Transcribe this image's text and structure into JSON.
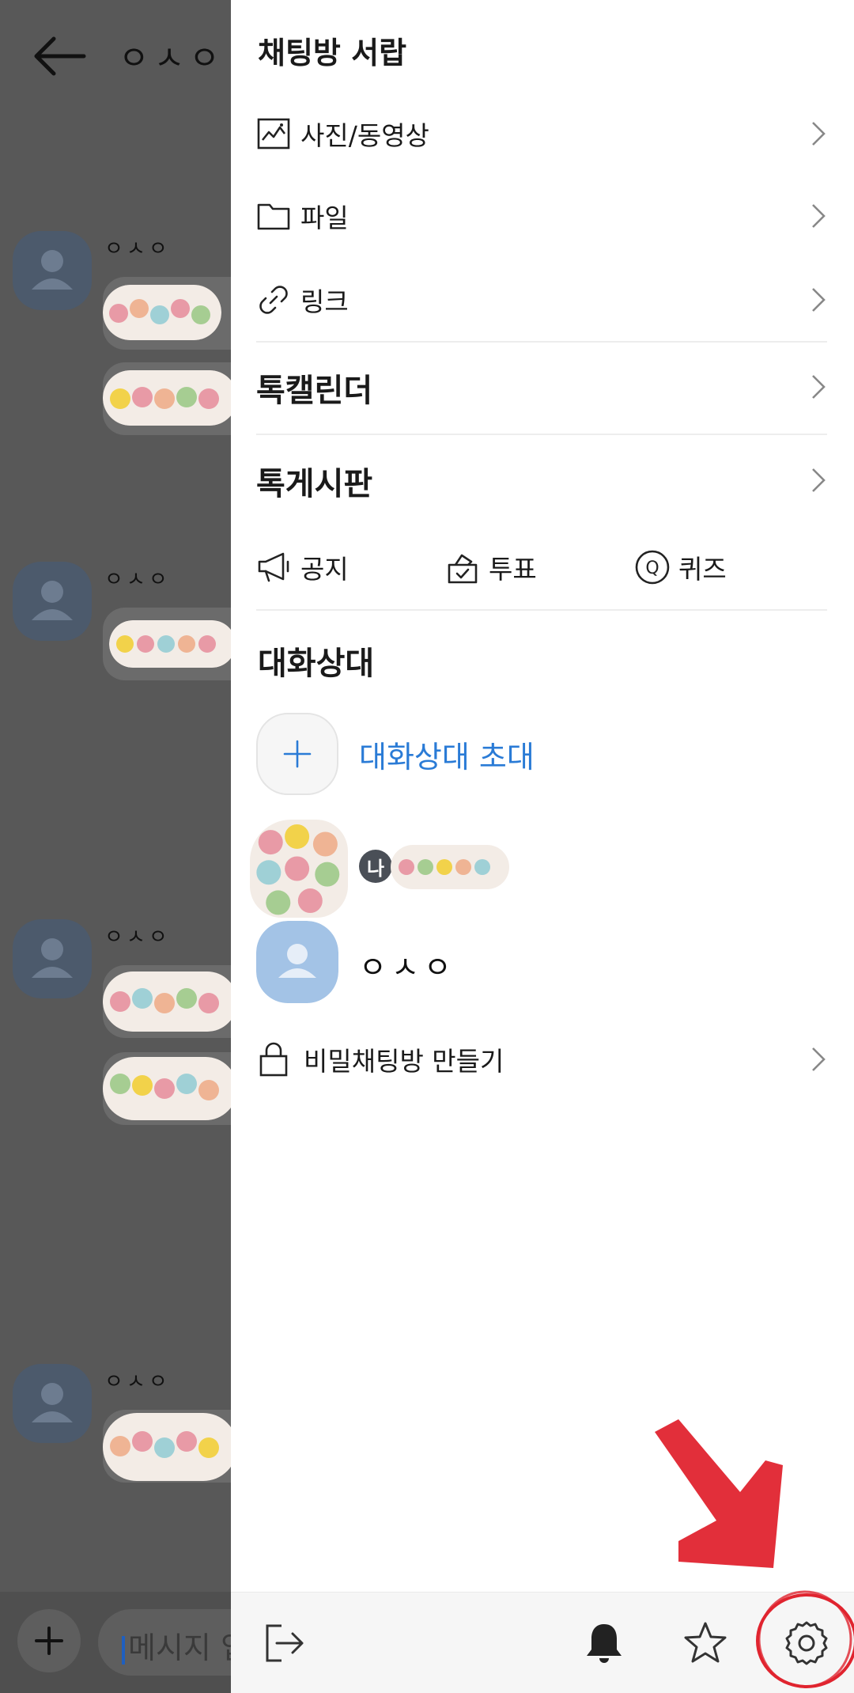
{
  "chat": {
    "title": "ㅇㅅㅇ",
    "messages": [
      {
        "sender": "ㅇㅅㅇ"
      },
      {
        "sender": "ㅇㅅㅇ"
      },
      {
        "sender": "ㅇㅅㅇ"
      },
      {
        "sender": "ㅇㅅㅇ"
      }
    ],
    "input_placeholder": "메시지 입"
  },
  "drawer": {
    "title": "채팅방 서랍",
    "items": [
      {
        "label": "사진/동영상",
        "icon": "photo-icon"
      },
      {
        "label": "파일",
        "icon": "folder-icon"
      },
      {
        "label": "링크",
        "icon": "link-icon"
      }
    ],
    "calendar_label": "톡캘린더",
    "board_label": "톡게시판",
    "tools": [
      {
        "label": "공지",
        "icon": "megaphone-icon"
      },
      {
        "label": "투표",
        "icon": "vote-icon"
      },
      {
        "label": "퀴즈",
        "icon": "quiz-icon"
      }
    ],
    "members_title": "대화상대",
    "invite_label": "대화상대 초대",
    "me_badge": "나",
    "member_name": "ㅇㅅㅇ",
    "secret_label": "비밀채팅방 만들기",
    "accent_color": "#2a7bd6",
    "annotation_color": "#e0242f"
  }
}
